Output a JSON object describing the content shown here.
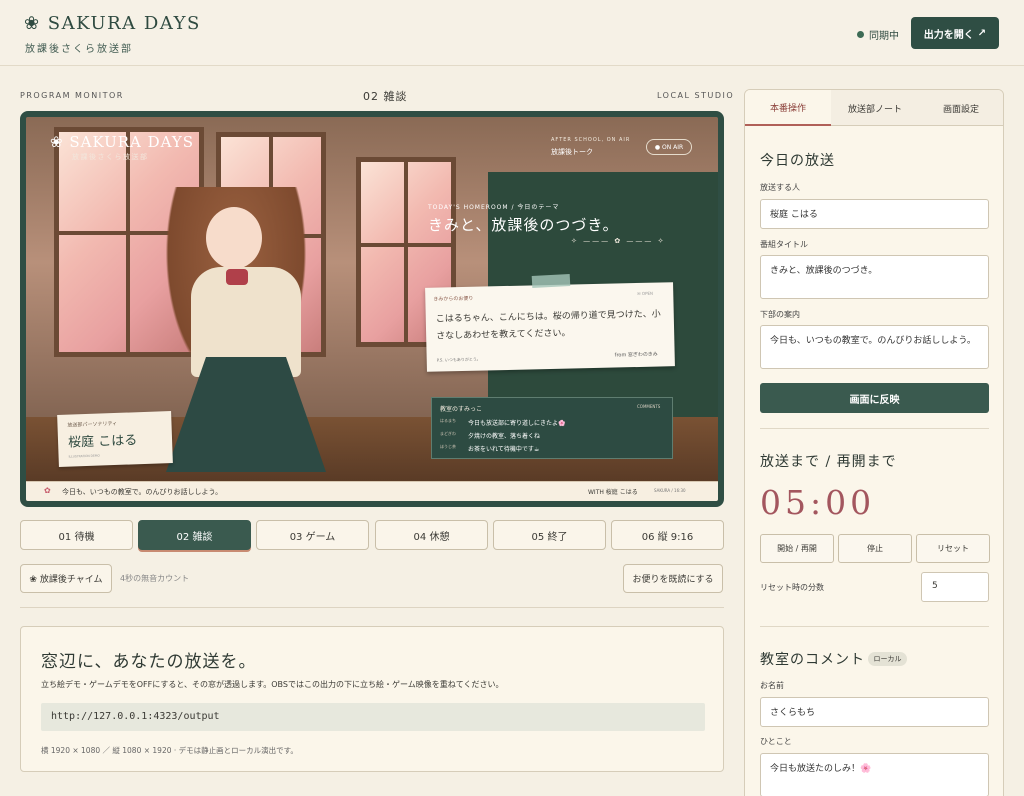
{
  "header": {
    "brand": "❀ SAKURA DAYS",
    "brand_sub": "放課後さくら放送部",
    "sync_status": "同期中",
    "open_output": "出力を開く",
    "open_output_icon": "↗"
  },
  "monitor": {
    "left_caption": "PROGRAM MONITOR",
    "title": "02 雑談",
    "right_caption": "LOCAL STUDIO"
  },
  "scene": {
    "logo": "❀ SAKURA DAYS",
    "logo_sub": "放課後さくら放送部",
    "after_small": "AFTER SCHOOL, ON AIR",
    "after_title": "放課後トーク",
    "on_air": "● ON AIR",
    "theme_small": "TODAY'S HOMEROOM / 今日のテーマ",
    "theme_title": "きみと、放課後のつづき。",
    "theme_deco": "✧ ——— ✿ ——— ✧",
    "letter": {
      "label": "きみからのお便り",
      "open": "✉ OPEN",
      "body": "こはるちゃん、こんにちは。桜の帰り道で見つけた、小さなしあわせを教えてください。",
      "ps": "P.S. いつもありがとう。",
      "from": "from 窓ぎわのきみ"
    },
    "comments": {
      "title": "教室のすみっこ",
      "label": "COMMENTS",
      "items": [
        {
          "name": "はるまち",
          "text": "今日も放送部に寄り道しにきたよ🌸"
        },
        {
          "name": "まどぎわ",
          "text": "夕焼けの教室、落ち着くね"
        },
        {
          "name": "ほうじ茶",
          "text": "お茶をいれて待機中です☕"
        }
      ]
    },
    "name_card": {
      "role": "放送部パーソナリティ",
      "name": "桜庭 こはる",
      "demo": "ILLUSTRATION DEMO"
    },
    "bottom_bar": {
      "text": "今日も、いつもの教室で。のんびりお話ししよう。",
      "with": "WITH 桜庭 こはる",
      "time": "SAKURA / 16:30"
    }
  },
  "scene_tabs": [
    {
      "label": "01 待機"
    },
    {
      "label": "02 雑談"
    },
    {
      "label": "03 ゲーム"
    },
    {
      "label": "04 休憩"
    },
    {
      "label": "05 終了"
    },
    {
      "label": "06 縦 9:16"
    }
  ],
  "active_scene": "02 雑談",
  "chime": {
    "label": "❀ 放課後チャイム",
    "note": "4秒の無音カウント"
  },
  "read_button": "お便りを既読にする",
  "info": {
    "title": "窓辺に、あなたの放送を。",
    "desc": "立ち絵デモ・ゲームデモをOFFにすると、その窓が透過します。OBSではこの出力の下に立ち絵・ゲーム映像を重ねてください。",
    "url": "http://127.0.0.1:4323/output",
    "size_note": "横 1920 × 1080 ／ 縦 1080 × 1920 · デモは静止画とローカル演出です。"
  },
  "panel": {
    "tabs": [
      "本番操作",
      "放送部ノート",
      "画面設定"
    ],
    "active_tab": "本番操作",
    "today_title": "今日の放送",
    "host_label": "放送する人",
    "host_value": "桜庭 こはる",
    "program_label": "番組タイトル",
    "program_value": "きみと、放課後のつづき。",
    "lower_label": "下部の案内",
    "lower_value": "今日も、いつもの教室で。のんびりお話ししよう。",
    "apply": "画面に反映",
    "timer_title": "放送まで / 再開まで",
    "timer_value": "05:00",
    "timer_buttons": [
      "開始 / 再開",
      "停止",
      "リセット"
    ],
    "reset_minutes_label": "リセット時の分数",
    "reset_minutes_value": "5",
    "comment_title": "教室のコメント",
    "comment_badge": "ローカル",
    "name_label": "お名前",
    "name_value": "さくらもち",
    "message_label": "ひとこと",
    "message_value": "今日も放送たのしみ！🌸"
  },
  "colors": {
    "accent": "#2f4e44",
    "timer": "#a3565e",
    "background": "#f5f0e4"
  }
}
